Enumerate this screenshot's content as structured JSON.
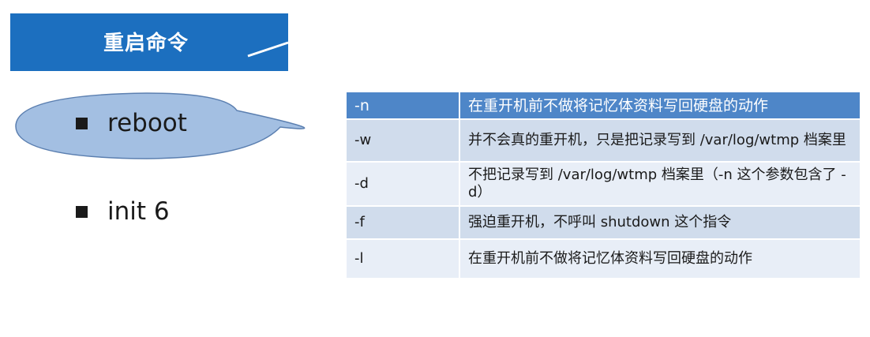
{
  "title": "重启命令",
  "colors": {
    "accent": "#1c6fbf",
    "table_header": "#4e86c8",
    "row_odd": "#d0dcec",
    "row_even": "#e8eef7",
    "callout": "#a3bfe2"
  },
  "bullets": [
    "reboot",
    "init 6"
  ],
  "table": {
    "rows": [
      {
        "opt": "-n",
        "desc": "在重开机前不做将记忆体资料写回硬盘的动作"
      },
      {
        "opt": "-w",
        "desc": "并不会真的重开机，只是把记录写到 /var/log/wtmp 档案里"
      },
      {
        "opt": "-d",
        "desc": "不把记录写到 /var/log/wtmp 档案里（-n 这个参数包含了 -d）"
      },
      {
        "opt": "-f",
        "desc": "强迫重开机，不呼叫 shutdown 这个指令"
      },
      {
        "opt": "-l",
        "desc": "在重开机前不做将记忆体资料写回硬盘的动作"
      }
    ]
  }
}
